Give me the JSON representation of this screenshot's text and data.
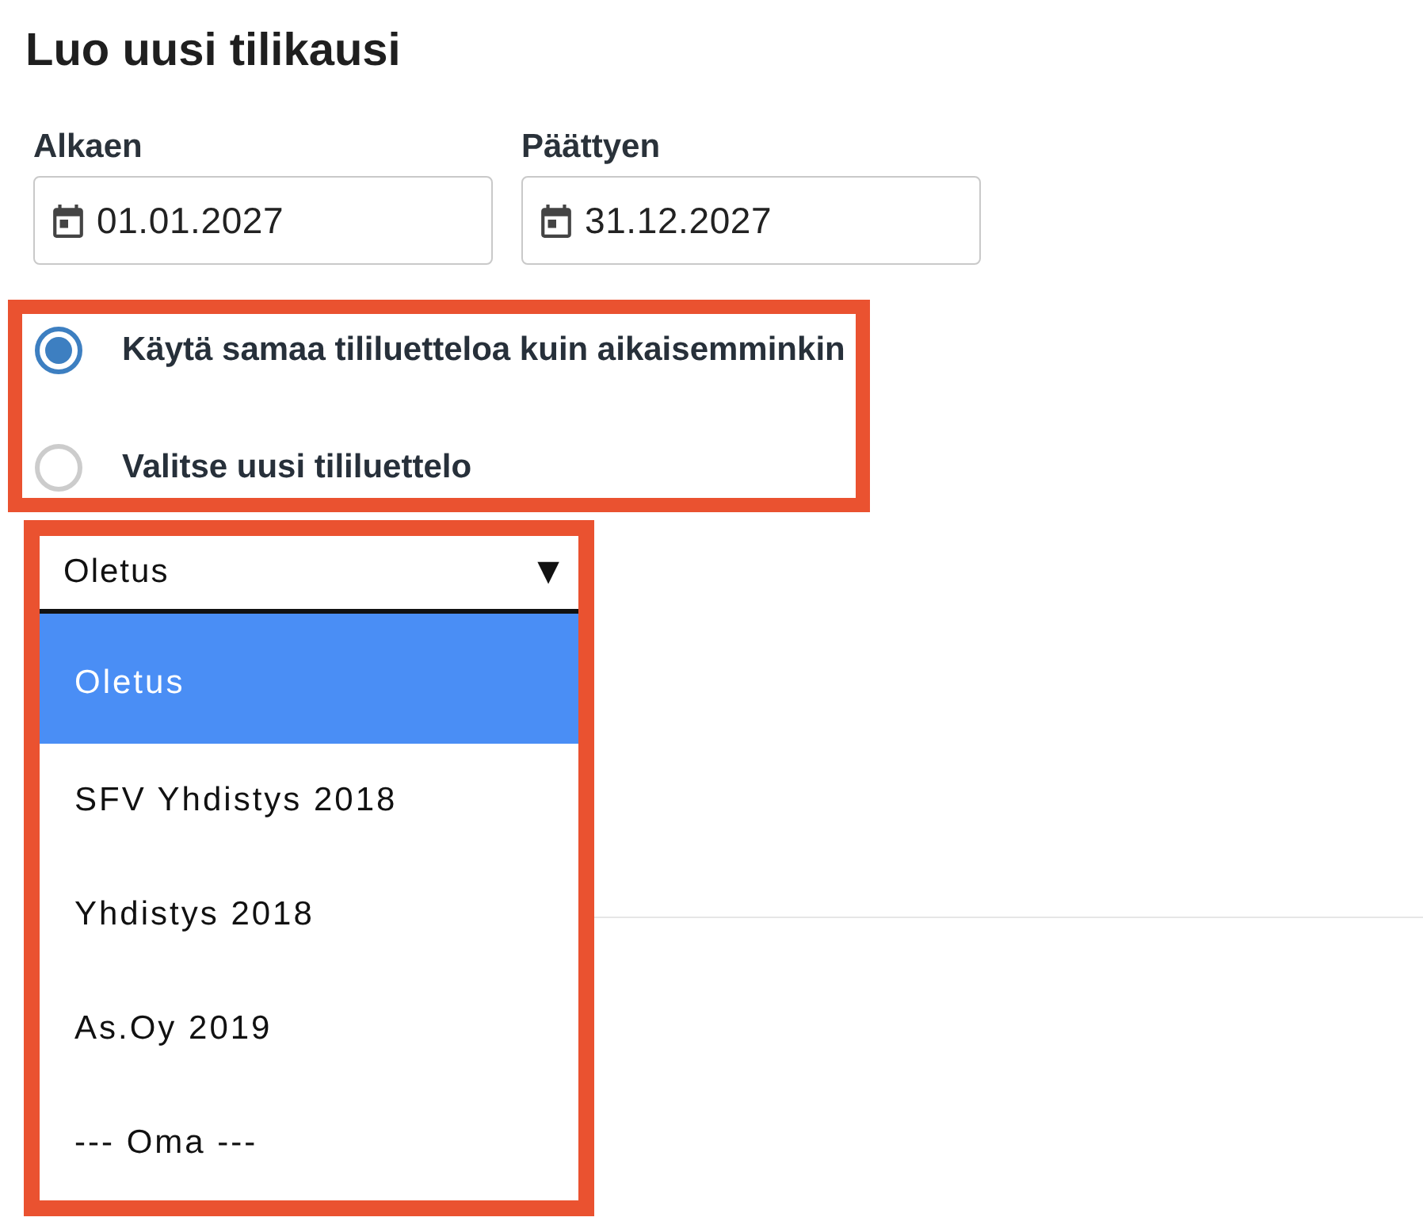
{
  "page": {
    "title": "Luo uusi tilikausi"
  },
  "period_fields": [
    {
      "label": "Alkaen",
      "value": "01.01.2027"
    },
    {
      "label": "Päättyen",
      "value": "31.12.2027"
    }
  ],
  "chart_choice": {
    "highlighted": true,
    "options": [
      {
        "label": "Käytä samaa tililuetteloa kuin aikaisemminkin",
        "selected": true
      },
      {
        "label": "Valitse uusi tililuettelo",
        "selected": false
      }
    ]
  },
  "chart_select": {
    "highlighted": true,
    "value": "Oletus",
    "arrow": "▼",
    "expanded": true,
    "options": [
      {
        "label": "Oletus",
        "selected": true
      },
      {
        "label": "SFV Yhdistys 2018",
        "selected": false
      },
      {
        "label": "Yhdistys 2018",
        "selected": false
      },
      {
        "label": "As.Oy 2019",
        "selected": false
      },
      {
        "label": "--- Oma ---",
        "selected": false
      }
    ]
  }
}
